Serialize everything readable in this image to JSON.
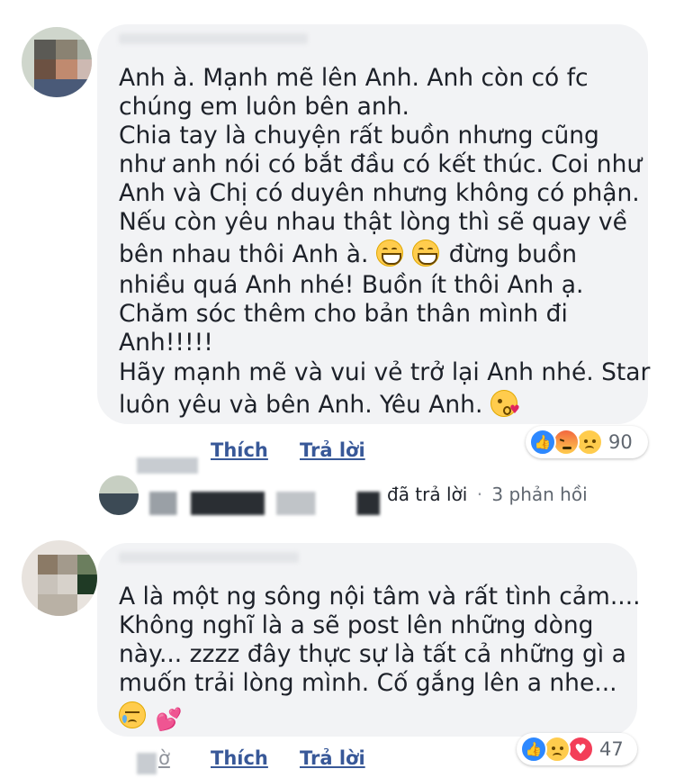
{
  "comment1": {
    "lines": [
      "Anh à. Mạnh mẽ lên Anh. Anh còn có fc",
      "chúng em luôn bên anh.",
      "Chia tay là chuyện rất buồn nhưng cũng",
      "như anh nói có bắt đầu có kết thúc. Coi như",
      "Anh và Chị có duyên nhưng không có phận.",
      "Nếu còn yêu nhau thật lòng thì sẽ quay về",
      "bên nhau thôi Anh à.",
      "đừng buồn",
      "nhiều quá Anh nhé!  Buồn ít thôi Anh ạ.",
      "Chăm sóc thêm cho bản thân mình đi",
      "Anh!!!!!",
      "Hãy mạnh mẽ và vui vẻ trở lại Anh nhé. Star",
      "luôn yêu và bên Anh. Yêu Anh."
    ],
    "emojis": [
      "grinning-face-emoji",
      "grinning-face-emoji",
      "face-blowing-kiss-emoji"
    ],
    "actions": {
      "like": "Thích",
      "reply": "Trả lời"
    },
    "reactions": {
      "types": [
        "like",
        "angry",
        "sad"
      ],
      "count": "90"
    },
    "replies": {
      "replied_text": "đã trả lời",
      "separator": "·",
      "count_text": "3 phản hồi"
    }
  },
  "comment2": {
    "lines": [
      "A là một ng sông nội tâm và rất tình cảm....",
      "Không nghĩ là a sẽ post lên những dòng",
      "này... zzzz đây thực sự là tất cả những gì a",
      "muốn trải lòng mình. Cố gắng lên a nhe..."
    ],
    "emojis": [
      "crying-face-emoji",
      "two-hearts-emoji"
    ],
    "actions": {
      "time_fragment": "ờ",
      "like": "Thích",
      "reply": "Trả lời"
    },
    "reactions": {
      "types": [
        "like",
        "sad",
        "love"
      ],
      "count": "47"
    }
  },
  "colors": {
    "bubble": "#f2f3f5",
    "link": "#385898",
    "like": "#2d88ff",
    "love": "#f33e58",
    "sad": "#ffcc4d",
    "meta": "#606770"
  }
}
